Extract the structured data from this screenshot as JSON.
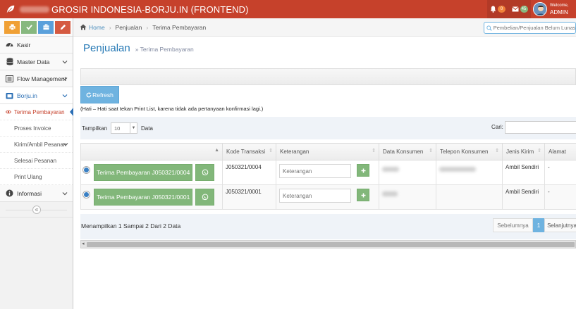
{
  "navbar": {
    "brand_title": "GROSIR INDONESIA-BORJU.IN (FRONTEND)",
    "notif_count": "0",
    "mail_count": "45",
    "welcome_label": "Welcome,",
    "user_name": "ADMIN",
    "bg_color": "#c6412b"
  },
  "sidebar": {
    "shortcuts": [
      {
        "icon": "print-icon",
        "color": "#f0a035"
      },
      {
        "icon": "check-icon",
        "color": "#87b87f"
      },
      {
        "icon": "briefcase-icon",
        "color": "#5aa0db"
      },
      {
        "icon": "pencil-icon",
        "color": "#d55a41"
      }
    ],
    "items": [
      {
        "label": "Kasir",
        "icon": "tachometer-icon"
      },
      {
        "label": "Master Data",
        "icon": "database-icon"
      },
      {
        "label": "Flow Management",
        "icon": "list-icon"
      },
      {
        "label": "Borju.in",
        "icon": "shopping-bag-icon"
      },
      {
        "label": "Informasi",
        "icon": "info-icon"
      }
    ],
    "submenu": [
      {
        "label": "Terima Pembayaran",
        "icon": "eye-icon"
      },
      {
        "label": "Proses Invoice"
      },
      {
        "label": "Kirim/Ambil Pesanan"
      },
      {
        "label": "Selesai Pesanan"
      },
      {
        "label": "Print Ulang"
      }
    ]
  },
  "breadcrumb": {
    "home": "Home",
    "level1": "Penjualan",
    "level2": "Terima Pembayaran"
  },
  "search": {
    "placeholder": "Pembelian/Penjualan Belum Lunas"
  },
  "page": {
    "title": "Penjualan",
    "subtitle": "Terima Pembayaran",
    "refresh_label": "Refresh",
    "warning": "(Hati – Hati saat tekan Print List, karena tidak ada pertanyaan konfirmasi lagi.)"
  },
  "table_controls": {
    "show_label": "Tampilkan",
    "show_value": "10",
    "data_label": "Data",
    "search_label": "Cari:"
  },
  "table": {
    "headers": [
      "",
      "Kode Transaksi",
      "Keterangan",
      "Data Konsumen",
      "Telepon Konsumen",
      "Jenis Kirim",
      "Alamat"
    ],
    "rows": [
      {
        "button": "Terima Pembayaran J050321/0004",
        "kode": "J050321/0004",
        "keterangan_placeholder": "Keterangan",
        "jenis_kirim": "Ambil Sendiri",
        "alamat": "-"
      },
      {
        "button": "Terima Pembayaran J050321/0001",
        "kode": "J050321/0001",
        "keterangan_placeholder": "Keterangan",
        "jenis_kirim": "Ambil Sendiri",
        "alamat": "-"
      }
    ]
  },
  "footer": {
    "info": "Menampilkan 1 Sampai 2 Dari 2 Data",
    "prev": "Sebelumnya",
    "page": "1",
    "next": "Selanjutnya"
  }
}
